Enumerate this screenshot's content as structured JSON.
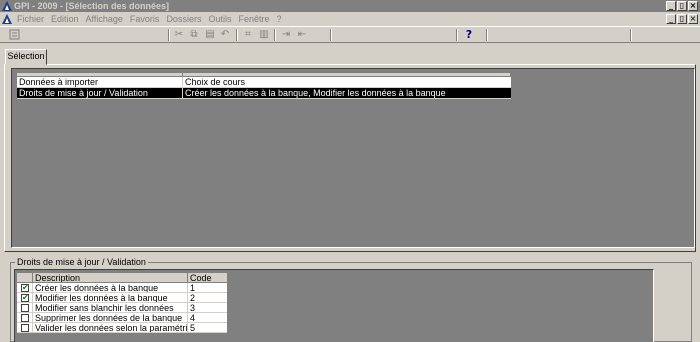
{
  "window": {
    "title": "GPI - 2009  - [Sélection des données]"
  },
  "menu": {
    "items": [
      "Fichier",
      "Edition",
      "Affichage",
      "Favoris",
      "Dossiers",
      "Outils",
      "Fenêtre",
      "?"
    ]
  },
  "window_buttons": {
    "minimize": "_",
    "restore": "▯",
    "close": "×"
  },
  "toolbar": {
    "help_label": "?",
    "icons": [
      "form-icon",
      "cut-icon",
      "copy-icon",
      "paste-icon",
      "undo-icon",
      "fit-icon",
      "book-icon",
      "indent-icon",
      "outdent-icon",
      "help-icon"
    ]
  },
  "tabs": [
    {
      "label": "Sélection",
      "active": true
    }
  ],
  "selection_grid": {
    "rows": [
      {
        "left": "Données à importer",
        "right": "Choix de cours",
        "selected": false
      },
      {
        "left": "Droits de mise à jour / Validation",
        "right": "Créer les données à la banque, Modifier les données à la banque",
        "selected": true
      }
    ]
  },
  "rights_group": {
    "legend": "Droits de mise à jour / Validation",
    "columns": {
      "description": "Description",
      "code": "Code"
    },
    "rows": [
      {
        "checked": true,
        "description": "Créer les données à la banque",
        "code": "1"
      },
      {
        "checked": true,
        "description": "Modifier les données à la banque",
        "code": "2"
      },
      {
        "checked": false,
        "description": "Modifier sans blanchir les données",
        "code": "3"
      },
      {
        "checked": false,
        "description": "Supprimer les données de la banque",
        "code": "4"
      },
      {
        "checked": false,
        "description": "Valider les données selon la paramétrisation",
        "code": "5"
      }
    ]
  },
  "colors": {
    "title_bar": "#808080",
    "face": "#d4d0c8",
    "workspace": "#808080",
    "selected_row": "#000000",
    "check": "#008000"
  }
}
